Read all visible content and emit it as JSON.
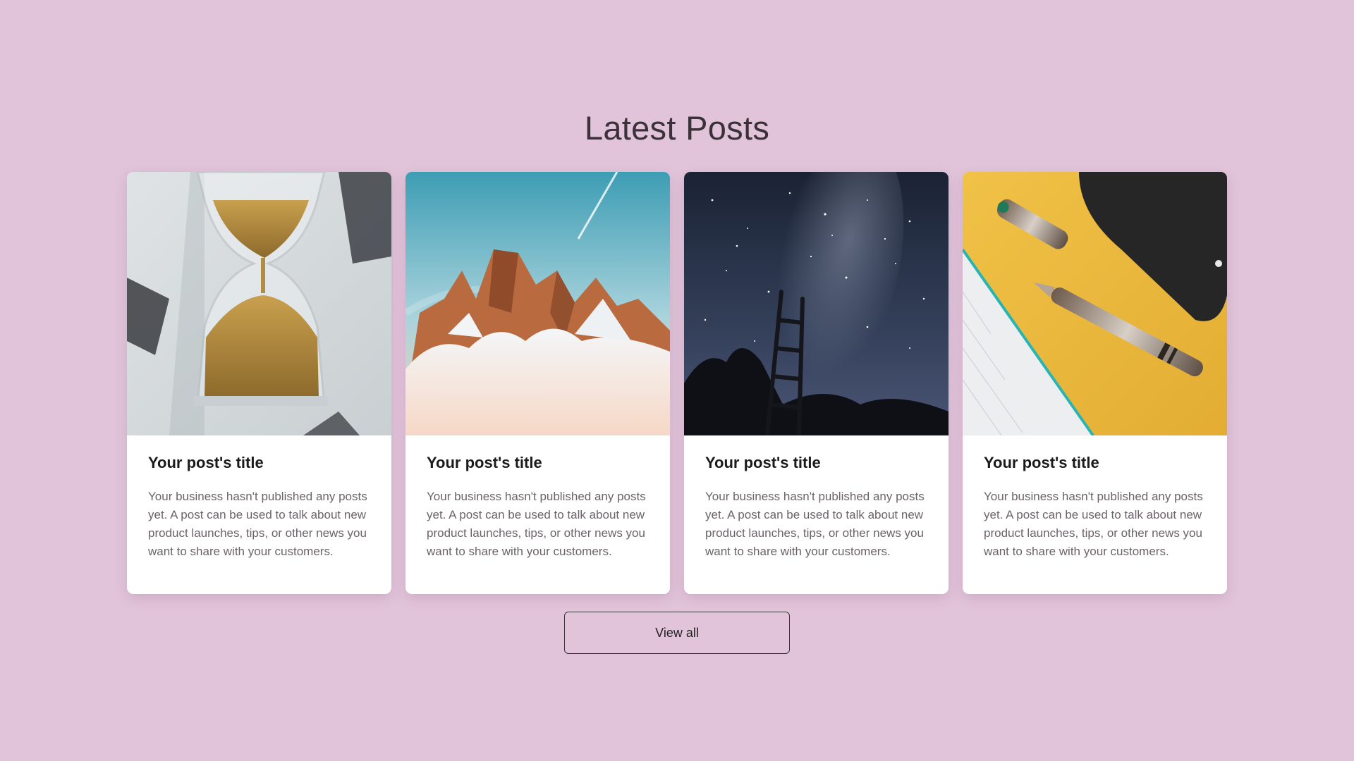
{
  "section": {
    "title": "Latest Posts"
  },
  "posts": [
    {
      "image": "hourglass-photo",
      "title": "Your post's title",
      "excerpt": "Your business hasn't published any posts yet. A post can be used to talk about new product launches, tips, or other news you want to share with your customers."
    },
    {
      "image": "snowy-mountain-photo",
      "title": "Your post's title",
      "excerpt": "Your business hasn't published any posts yet. A post can be used to talk about new product launches, tips, or other news you want to share with your customers."
    },
    {
      "image": "night-sky-ladder-photo",
      "title": "Your post's title",
      "excerpt": "Your business hasn't published any posts yet. A post can be used to talk about new product launches, tips, or other news you want to share with your customers."
    },
    {
      "image": "fountain-pen-notebook-photo",
      "title": "Your post's title",
      "excerpt": "Your business hasn't published any posts yet. A post can be used to talk about new product launches, tips, or other news you want to share with your customers."
    }
  ],
  "actions": {
    "view_all_label": "View all"
  },
  "colors": {
    "page_background": "#e1c4da",
    "card_background": "#ffffff",
    "title_text": "#3a3238",
    "body_text": "#6b6369"
  }
}
